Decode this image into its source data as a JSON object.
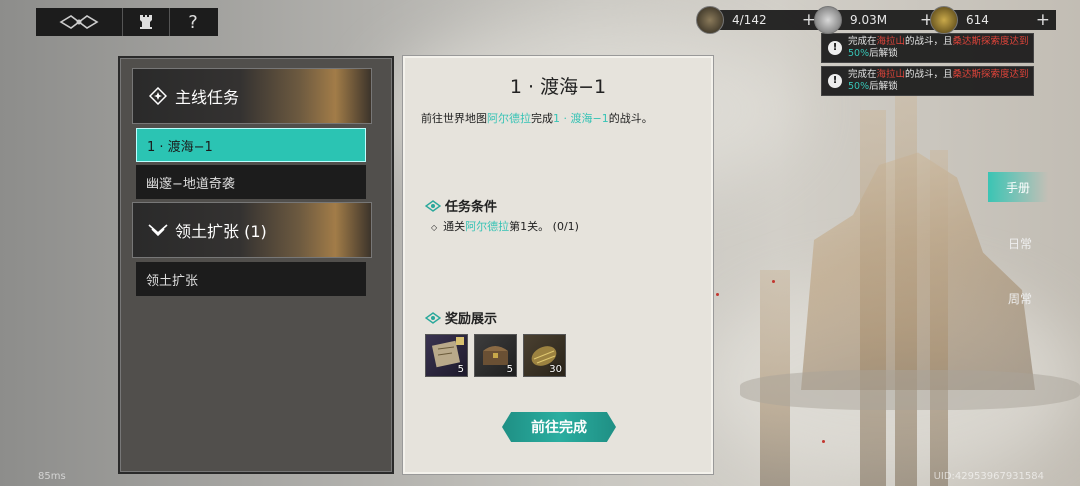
{
  "topbar": {
    "logo_icon": "emblem-icon",
    "tower_icon": "rook-icon",
    "help_label": "?",
    "resources": [
      {
        "name": "stamina",
        "icon": "horn-icon",
        "value": "4/142"
      },
      {
        "name": "silver",
        "icon": "coin-icon",
        "value": "9.03M"
      },
      {
        "name": "gold",
        "icon": "gold-coin-icon",
        "value": "614"
      }
    ],
    "plus_label": "+"
  },
  "toasts": [
    {
      "pre": "完成在",
      "place": "海拉山",
      "mid": "的战斗，且",
      "region": "桑达斯探索度达到",
      "pct": "50%",
      "post": "后解锁"
    },
    {
      "pre": "完成在",
      "place": "海拉山",
      "mid": "的战斗，且",
      "region": "桑达斯探索度达到",
      "pct": "50%",
      "post": "后解锁"
    }
  ],
  "sidebar": {
    "categories": [
      {
        "label": "主线任务",
        "icon": "star-diamond-icon"
      },
      {
        "label": "领土扩张 (1)",
        "icon": "wings-chevron-icon"
      }
    ],
    "items": [
      {
        "label": "1 · 渡海−1",
        "active": true
      },
      {
        "label": "幽邃−地道奇袭",
        "active": false
      },
      {
        "label": "领土扩张",
        "active": false
      }
    ]
  },
  "quest": {
    "title": "1 · 渡海−1",
    "desc_pre": "前往世界地图",
    "desc_place": "阿尔德拉",
    "desc_mid": "完成",
    "desc_stage": "1 · 渡海−1",
    "desc_post": "的战斗。",
    "conditions_title": "任务条件",
    "condition_pre": "通关",
    "condition_place": "阿尔德拉",
    "condition_post": "第1关。 (0/1)",
    "rewards_title": "奖励展示",
    "rewards": [
      {
        "icon": "map-scroll-icon",
        "count": "5"
      },
      {
        "icon": "treasure-chest-icon",
        "count": "5"
      },
      {
        "icon": "gold-ore-icon",
        "count": "30"
      }
    ],
    "go_button": "前往完成"
  },
  "right_tabs": [
    {
      "label": "手册",
      "active": true
    },
    {
      "label": "日常",
      "active": false
    },
    {
      "label": "周常",
      "active": false
    }
  ],
  "footer": {
    "fps": "85ms",
    "uid": "UID:42953967931584"
  },
  "colors": {
    "accent": "#2bc4b3",
    "highlight_red": "#e0443a",
    "link_teal": "#36c3b5"
  }
}
